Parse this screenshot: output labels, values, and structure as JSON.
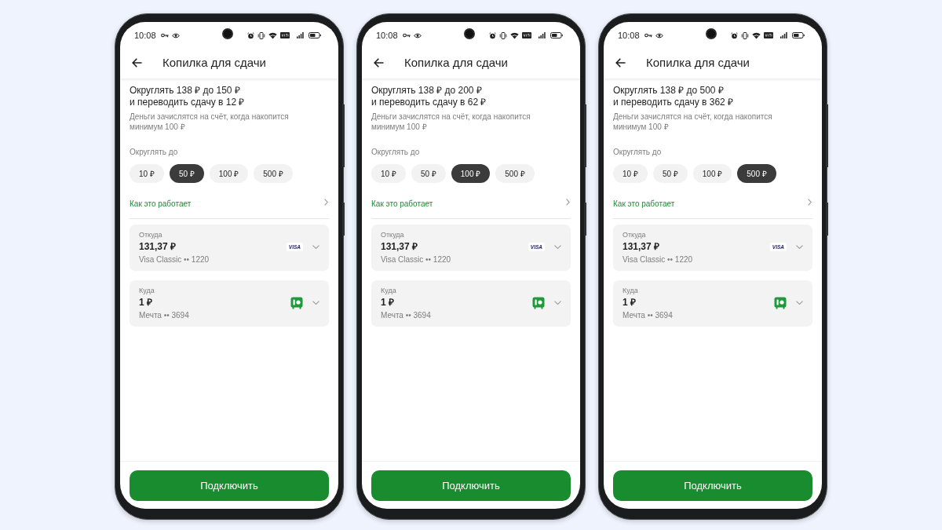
{
  "phones": [
    {
      "status_bar": {
        "time": "10:08"
      },
      "header": {
        "title": "Копилка для сдачи"
      },
      "summary": {
        "title": "Округлять 138 ₽ до 150 ₽\nи переводить сдачу в 12 ₽",
        "note": "Деньги зачислятся на счёт, когда накопится минимум 100 ₽"
      },
      "round_to": {
        "label": "Округлять до",
        "options": [
          {
            "label": "10 ₽",
            "selected": false
          },
          {
            "label": "50 ₽",
            "selected": true
          },
          {
            "label": "100 ₽",
            "selected": false
          },
          {
            "label": "500 ₽",
            "selected": false
          }
        ]
      },
      "link": "Как это работает",
      "accounts": [
        {
          "kind": "card",
          "label": "Откуда",
          "amount": "131,37 ₽",
          "name": "Visa Classic •• 1220",
          "logo": "VISA"
        },
        {
          "kind": "savings",
          "label": "Куда",
          "amount": "1 ₽",
          "name": "Мечта •• 3694"
        }
      ],
      "button": "Подключить"
    },
    {
      "status_bar": {
        "time": "10:08"
      },
      "header": {
        "title": "Копилка для сдачи"
      },
      "summary": {
        "title": "Округлять 138 ₽ до 200 ₽\nи переводить сдачу в 62 ₽",
        "note": "Деньги зачислятся на счёт, когда накопится минимум 100 ₽"
      },
      "round_to": {
        "label": "Округлять до",
        "options": [
          {
            "label": "10 ₽",
            "selected": false
          },
          {
            "label": "50 ₽",
            "selected": false
          },
          {
            "label": "100 ₽",
            "selected": true
          },
          {
            "label": "500 ₽",
            "selected": false
          }
        ]
      },
      "link": "Как это работает",
      "accounts": [
        {
          "kind": "card",
          "label": "Откуда",
          "amount": "131,37 ₽",
          "name": "Visa Classic •• 1220",
          "logo": "VISA"
        },
        {
          "kind": "savings",
          "label": "Куда",
          "amount": "1 ₽",
          "name": "Мечта •• 3694"
        }
      ],
      "button": "Подключить"
    },
    {
      "status_bar": {
        "time": "10:08"
      },
      "header": {
        "title": "Копилка для сдачи"
      },
      "summary": {
        "title": "Округлять 138 ₽ до 500 ₽\nи переводить сдачу в 362 ₽",
        "note": "Деньги зачислятся на счёт, когда накопится минимум 100 ₽"
      },
      "round_to": {
        "label": "Округлять до",
        "options": [
          {
            "label": "10 ₽",
            "selected": false
          },
          {
            "label": "50 ₽",
            "selected": false
          },
          {
            "label": "100 ₽",
            "selected": false
          },
          {
            "label": "500 ₽",
            "selected": true
          }
        ]
      },
      "link": "Как это работает",
      "accounts": [
        {
          "kind": "card",
          "label": "Откуда",
          "amount": "131,37 ₽",
          "name": "Visa Classic •• 1220",
          "logo": "VISA"
        },
        {
          "kind": "savings",
          "label": "Куда",
          "amount": "1 ₽",
          "name": "Мечта •• 3694"
        }
      ],
      "button": "Подключить"
    }
  ]
}
